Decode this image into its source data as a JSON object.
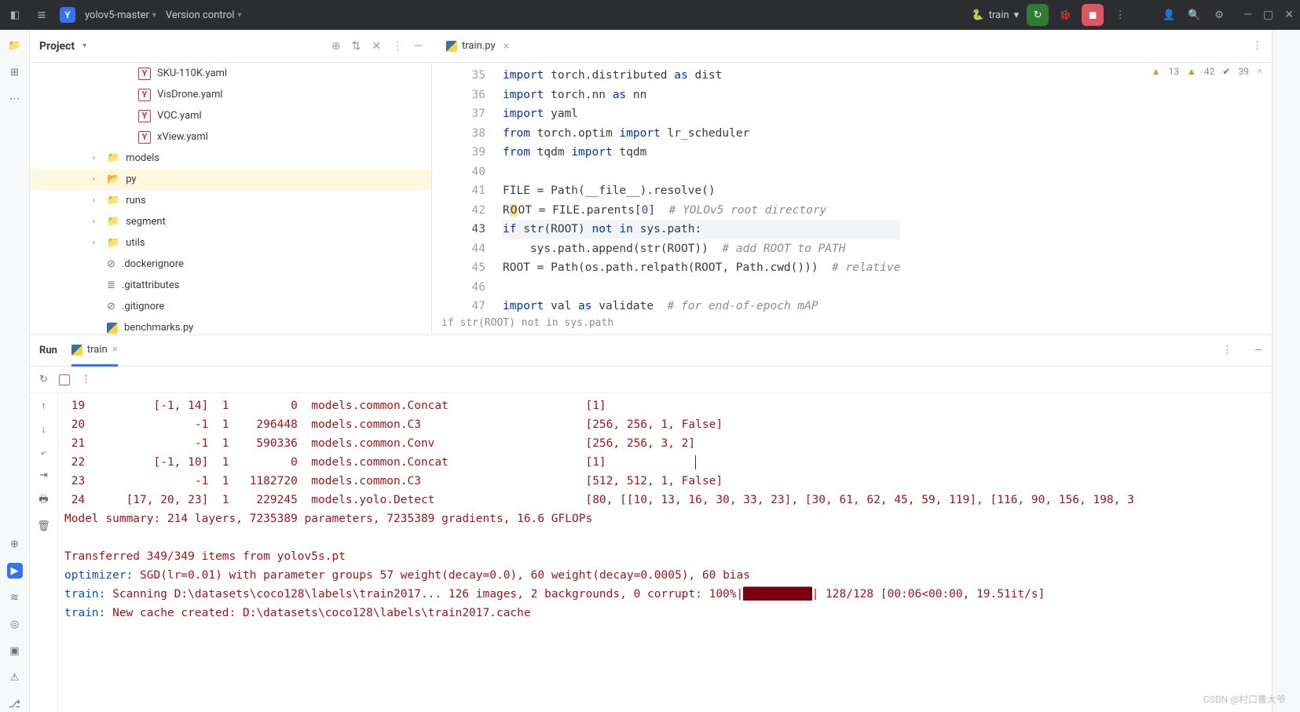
{
  "titlebar": {
    "project_badge": "Y",
    "project_name": "yolov5-master",
    "vcs_menu": "Version control",
    "run_config": "train",
    "tools": {
      "debug": "debug",
      "stop": "stop",
      "more": "more"
    },
    "right": {
      "code_with_me": "",
      "search": "",
      "settings": ""
    },
    "win": {
      "min": "min",
      "max": "max",
      "close": "close"
    }
  },
  "project_panel": {
    "title": "Project",
    "items": [
      {
        "type": "file",
        "icon": "yaml",
        "label": "SKU-110K.yaml",
        "indent": 2
      },
      {
        "type": "file",
        "icon": "yaml",
        "label": "VisDrone.yaml",
        "indent": 2
      },
      {
        "type": "file",
        "icon": "yaml",
        "label": "VOC.yaml",
        "indent": 2
      },
      {
        "type": "file",
        "icon": "yaml",
        "label": "xView.yaml",
        "indent": 2
      },
      {
        "type": "folder",
        "label": "models",
        "indent": 1,
        "arrow": true
      },
      {
        "type": "folder-open",
        "label": "py",
        "indent": 1,
        "arrow": true,
        "selected": true
      },
      {
        "type": "folder",
        "label": "runs",
        "indent": 1,
        "arrow": true
      },
      {
        "type": "folder",
        "label": "segment",
        "indent": 1,
        "arrow": true
      },
      {
        "type": "folder",
        "label": "utils",
        "indent": 1,
        "arrow": true
      },
      {
        "type": "file",
        "icon": "ignore",
        "label": ".dockerignore",
        "indent": 1
      },
      {
        "type": "file",
        "icon": "text",
        "label": ".gitattributes",
        "indent": 1
      },
      {
        "type": "file",
        "icon": "ignore",
        "label": ".gitignore",
        "indent": 1
      },
      {
        "type": "file",
        "icon": "py",
        "label": "benchmarks.py",
        "indent": 1
      }
    ]
  },
  "editor": {
    "tab_name": "train.py",
    "inspections": {
      "w1": "13",
      "w2": "42",
      "ok": "39"
    },
    "breadcrumb": "if str(ROOT) not in sys.path",
    "gutter_start": 35,
    "current_line": 43,
    "lines": [
      {
        "n": 35,
        "html": "<span class='kw'>import</span> torch.distributed <span class='kw'>as</span> dist"
      },
      {
        "n": 36,
        "html": "<span class='kw'>import</span> torch.nn <span class='kw'>as</span> nn"
      },
      {
        "n": 37,
        "html": "<span class='kw'>import</span> yaml"
      },
      {
        "n": 38,
        "html": "<span class='kw'>from</span> torch.optim <span class='kw'>import</span> lr_scheduler"
      },
      {
        "n": 39,
        "html": "<span class='kw'>from</span> tqdm <span class='kw'>import</span> tqdm"
      },
      {
        "n": 40,
        "html": ""
      },
      {
        "n": 41,
        "html": "FILE = Path(__file__).resolve()"
      },
      {
        "n": 42,
        "html": "R<span class='highlight-caret'>O</span>OT = FILE.parents[<span class='num'>0</span>]  <span class='cm'># YOLOv5 root directory</span>"
      },
      {
        "n": 43,
        "html": "<span class='kw'>if</span> str(ROOT) <span class='kw'>not</span> <span class='kw'>in</span> sys.path:"
      },
      {
        "n": 44,
        "html": "    sys.path.append(str(ROOT))  <span class='cm'># add ROOT to PATH</span>"
      },
      {
        "n": 45,
        "html": "ROOT = Path(os.path.relpath(ROOT, Path.cwd()))  <span class='cm'># relative</span>"
      },
      {
        "n": 46,
        "html": ""
      },
      {
        "n": 47,
        "html": "<span class='kw'>import</span> val <span class='kw'>as</span> validate  <span class='cm'># for end-of-epoch mAP</span>"
      }
    ]
  },
  "runpanel": {
    "tab_run": "Run",
    "tab_train": "train",
    "console_html": "<span class='red'> 19          [-1, 14]  1         0  models.common.Concat                    [1]</span>\n<span class='red'> 20                -1  1    296448  models.common.C3                        [256, 256, 1, False]</span>\n<span class='red'> 21                -1  1    590336  models.common.Conv                      [256, 256, 3, 2]</span>\n<span class='red'> 22          [-1, 10]  1         0  models.common.Concat                    [1]</span>             <span class='textcursor'></span>\n<span class='red'> 23                -1  1   1182720  models.common.C3                        [512, 512, 1, False]</span>\n<span class='red'> 24      [17, 20, 23]  1    229245  models.yolo.Detect                      [80, [[10, 13, 16, 30, 33, 23], [30, 61, 62, 45, 59, 119], [116, 90, 156, 198, 3</span>\n<span class='red'>Model summary: 214 layers, 7235389 parameters, 7235389 gradients, 16.6 GFLOPs</span>\n\n<span class='red'>Transferred 349/349 items from yolov5s.pt</span>\n<span class='blue'>optimizer:</span> <span class='red'>SGD(lr=0.01) with parameter groups 57 weight(decay=0.0), 60 weight(decay=0.0005), 60 bias</span>\n<span class='blue'>train: </span><span class='red'>Scanning D:\\datasets\\coco128\\labels\\train2017... 126 images, 2 backgrounds, 0 corrupt: 100%|</span><span class='bar'>██████████</span><span class='red'>| 128/128 [00:06&lt;00:00, 19.51it/s]</span>\n<span class='blue'>train: </span><span class='red'>New cache created: D:\\datasets\\coco128\\labels\\train2017.cache</span>"
  },
  "watermark": "CSDN @村口曹大爷"
}
